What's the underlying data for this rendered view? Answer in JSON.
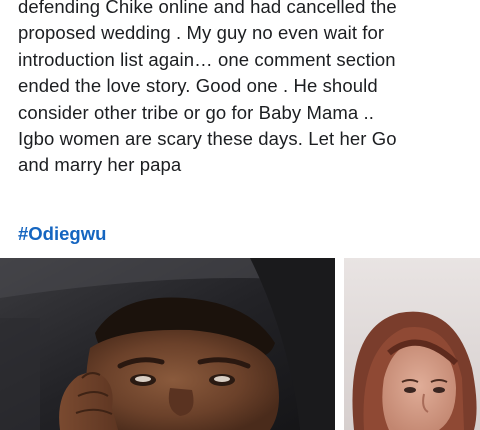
{
  "post": {
    "lines": [
      "defending Chike online and had cancelled the",
      "proposed wedding . My guy no even wait for",
      "introduction list again… one comment section",
      "ended the love story. Good one . He should",
      "consider other tribe or go for Baby Mama  ..",
      "Igbo women are scary these days. Let her Go",
      "and marry her papa"
    ],
    "hashtag": "#Odiegwu"
  },
  "colors": {
    "text": "#1c1e21",
    "hashtag": "#1565c0"
  },
  "photos": [
    {
      "subject": "man-selfie-in-car"
    },
    {
      "subject": "woman-portrait"
    }
  ]
}
